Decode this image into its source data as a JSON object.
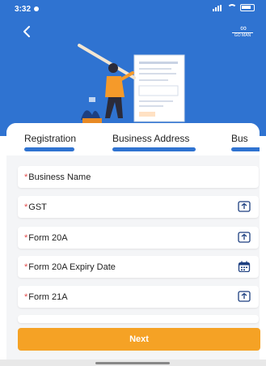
{
  "status_bar": {
    "time": "3:32"
  },
  "header": {
    "logo_text": "GO MAN"
  },
  "tabs": [
    {
      "label": "Registration"
    },
    {
      "label": "Business Address"
    },
    {
      "label": "Bus"
    }
  ],
  "fields": [
    {
      "label": "Business Name",
      "required_mark": "*"
    },
    {
      "label": "GST",
      "required_mark": "*",
      "icon": "upload-icon"
    },
    {
      "label": "Form 20A",
      "required_mark": "*",
      "icon": "upload-icon"
    },
    {
      "label": "Form 20A Expiry Date",
      "required_mark": "*",
      "icon": "calendar-icon"
    },
    {
      "label": "Form 21A",
      "required_mark": "*",
      "icon": "upload-icon"
    }
  ],
  "next_button": {
    "label": "Next"
  },
  "colors": {
    "primary": "#2f73d1",
    "accent": "#f5a225",
    "required": "#e24b4b"
  }
}
